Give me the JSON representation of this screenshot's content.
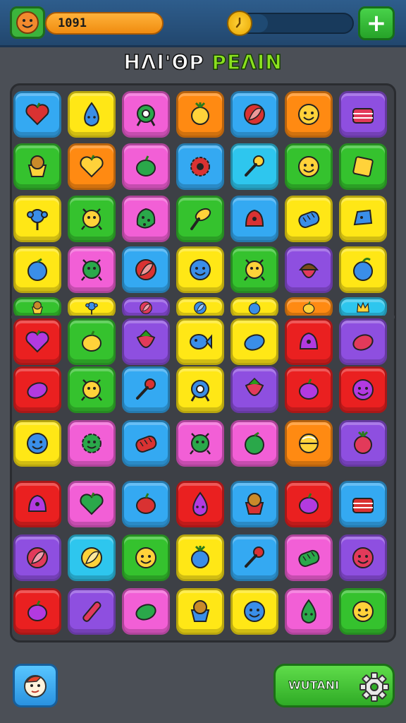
{
  "hud": {
    "score": "1091",
    "timer_level": 0.25,
    "plus_label": "+"
  },
  "title": {
    "part1": "ΗΛΙ'ΘP",
    "part2": "PΕΛΙΝ"
  },
  "bottom": {
    "action_label": "WUTANI"
  },
  "colors": {
    "blue": "#34a9f2",
    "yellow": "#ffe716",
    "pink": "#f25fd6",
    "orange": "#ff8a12",
    "purple": "#8e4fe0",
    "green": "#35c22e",
    "red": "#ea2020",
    "cyan": "#2ec6ee",
    "lime": "#8fe01d"
  },
  "board": {
    "rows": [
      [
        [
          "blue",
          "heart"
        ],
        [
          "yellow",
          "drop"
        ],
        [
          "pink",
          "ring"
        ],
        [
          "orange",
          "berry"
        ],
        [
          "blue",
          "leaf"
        ],
        [
          "orange",
          "face"
        ],
        [
          "purple",
          "cake"
        ]
      ],
      [
        [
          "green",
          "cup"
        ],
        [
          "orange",
          "heart"
        ],
        [
          "pink",
          "plum"
        ],
        [
          "blue",
          "gear"
        ],
        [
          "cyan",
          "key"
        ],
        [
          "green",
          "face"
        ],
        [
          "green",
          "box"
        ]
      ],
      [
        [
          "yellow",
          "sprout"
        ],
        [
          "green",
          "critter"
        ],
        [
          "pink",
          "spotted"
        ],
        [
          "green",
          "brush"
        ],
        [
          "blue",
          "blob"
        ],
        [
          "yellow",
          "bread"
        ],
        [
          "yellow",
          "chip"
        ]
      ],
      [
        [
          "yellow",
          "orange"
        ],
        [
          "pink",
          "critter"
        ],
        [
          "blue",
          "leaf"
        ],
        [
          "yellow",
          "face"
        ],
        [
          "green",
          "critter"
        ],
        [
          "purple",
          "acorn"
        ],
        [
          "yellow",
          "apple"
        ]
      ],
      [
        [
          "green",
          "cup"
        ],
        [
          "yellow",
          "sprout"
        ],
        [
          "purple",
          "leaf"
        ],
        [
          "yellow",
          "leaf"
        ],
        [
          "yellow",
          "orange"
        ],
        [
          "orange",
          "plum"
        ],
        [
          "cyan",
          "crown"
        ]
      ],
      [
        [
          "red",
          "heart"
        ],
        [
          "green",
          "plum"
        ],
        [
          "purple",
          "strawberry"
        ],
        [
          "yellow",
          "fish"
        ],
        [
          "yellow",
          "lemon"
        ],
        [
          "red",
          "blob"
        ],
        [
          "purple",
          "lemon"
        ]
      ],
      [
        [
          "red",
          "lemon"
        ],
        [
          "green",
          "critter"
        ],
        [
          "blue",
          "key"
        ],
        [
          "yellow",
          "ring"
        ],
        [
          "purple",
          "strawberry"
        ],
        [
          "red",
          "plum"
        ],
        [
          "red",
          "face"
        ]
      ],
      [
        [
          "yellow",
          "face"
        ],
        [
          "pink",
          "sun"
        ],
        [
          "blue",
          "bread"
        ],
        [
          "pink",
          "critter"
        ],
        [
          "pink",
          "orange"
        ],
        [
          "orange",
          "ball"
        ],
        [
          "purple",
          "berry"
        ]
      ],
      [
        [
          "red",
          "blob"
        ],
        [
          "pink",
          "heart"
        ],
        [
          "blue",
          "plum"
        ],
        [
          "red",
          "drop"
        ],
        [
          "blue",
          "cup"
        ],
        [
          "red",
          "plum"
        ],
        [
          "blue",
          "cake"
        ]
      ],
      [
        [
          "purple",
          "leaf"
        ],
        [
          "cyan",
          "leaf"
        ],
        [
          "green",
          "face"
        ],
        [
          "yellow",
          "berry"
        ],
        [
          "blue",
          "key"
        ],
        [
          "pink",
          "bread"
        ],
        [
          "purple",
          "face"
        ]
      ],
      [
        [
          "red",
          "plum"
        ],
        [
          "purple",
          "stick"
        ],
        [
          "pink",
          "lemon"
        ],
        [
          "yellow",
          "cup"
        ],
        [
          "yellow",
          "face"
        ],
        [
          "pink",
          "drop"
        ],
        [
          "green",
          "face"
        ]
      ]
    ]
  }
}
